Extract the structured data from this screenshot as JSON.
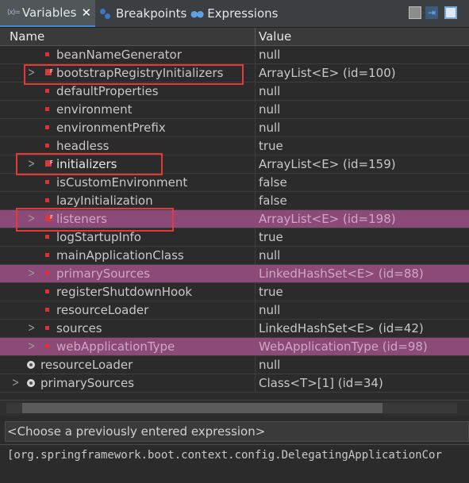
{
  "tabs": [
    {
      "label": "Variables",
      "icon": "variables-icon",
      "active": true
    },
    {
      "label": "Breakpoints",
      "icon": "breakpoints-icon"
    },
    {
      "label": "Expressions",
      "icon": "expressions-icon"
    }
  ],
  "tab_icon_text": "(x)=",
  "columns": {
    "name": "Name",
    "value": "Value"
  },
  "rows": [
    {
      "name": "beanNameGenerator",
      "value": "null"
    },
    {
      "name": "bootstrapRegistryInitializers",
      "value": "ArrayList<E>  (id=100)"
    },
    {
      "name": "defaultProperties",
      "value": "null"
    },
    {
      "name": "environment",
      "value": "null"
    },
    {
      "name": "environmentPrefix",
      "value": "null"
    },
    {
      "name": "headless",
      "value": "true"
    },
    {
      "name": "initializers",
      "value": "ArrayList<E>  (id=159)"
    },
    {
      "name": "isCustomEnvironment",
      "value": "false"
    },
    {
      "name": "lazyInitialization",
      "value": "false"
    },
    {
      "name": "listeners",
      "value": "ArrayList<E>  (id=198)"
    },
    {
      "name": "logStartupInfo",
      "value": "true"
    },
    {
      "name": "mainApplicationClass",
      "value": "null"
    },
    {
      "name": "primarySources",
      "value": "LinkedHashSet<E>  (id=88)"
    },
    {
      "name": "registerShutdownHook",
      "value": "true"
    },
    {
      "name": "resourceLoader",
      "value": "null"
    },
    {
      "name": "sources",
      "value": "LinkedHashSet<E>  (id=42)"
    },
    {
      "name": "webApplicationType",
      "value": "WebApplicationType  (id=98)"
    },
    {
      "name": "resourceLoader",
      "value": "null"
    },
    {
      "name": "primarySources",
      "value": "Class<T>[1]  (id=34)"
    }
  ],
  "expression_placeholder": "<Choose a previously entered expression>",
  "detail_text": "[org.springframework.boot.context.config.DelegatingApplicationCor",
  "colors": {
    "highlight_row": "#8c4a78",
    "annotation_box": "#e53935",
    "active_tab": "#515658"
  }
}
